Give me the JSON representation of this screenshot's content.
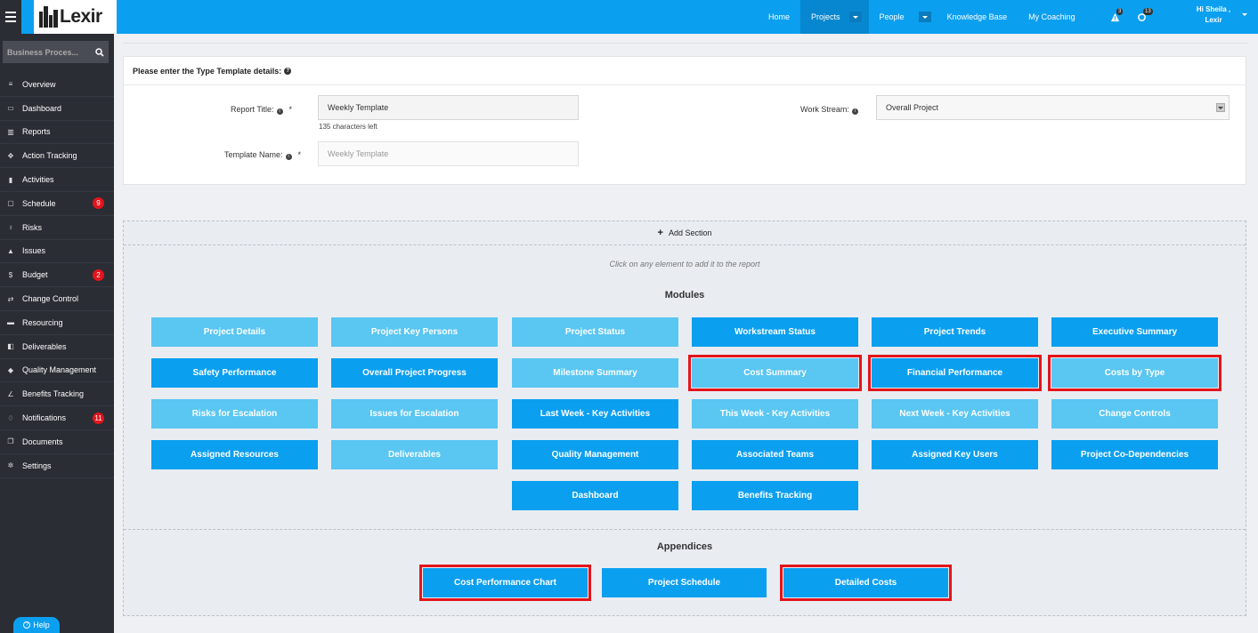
{
  "header": {
    "logo_text": "Lexir",
    "nav": [
      {
        "label": "Home"
      },
      {
        "label": "Projects"
      },
      {
        "label": "People"
      },
      {
        "label": "Knowledge Base"
      },
      {
        "label": "My Coaching"
      }
    ],
    "alerts_count": "3",
    "messages_count": "13",
    "greeting_line1": "Hi Sheila ,",
    "greeting_line2": "Lexir"
  },
  "sidebar": {
    "search_placeholder": "Business Proces...",
    "items": [
      {
        "label": "Overview",
        "icon": "list-icon"
      },
      {
        "label": "Dashboard",
        "icon": "dashboard-icon"
      },
      {
        "label": "Reports",
        "icon": "bar-chart-icon"
      },
      {
        "label": "Action Tracking",
        "icon": "crosshair-icon"
      },
      {
        "label": "Activities",
        "icon": "bookmark-icon"
      },
      {
        "label": "Schedule",
        "icon": "calendar-icon",
        "badge": "9"
      },
      {
        "label": "Risks",
        "icon": "lightbulb-icon"
      },
      {
        "label": "Issues",
        "icon": "warning-icon"
      },
      {
        "label": "Budget",
        "icon": "dollar-icon",
        "badge": "2"
      },
      {
        "label": "Change Control",
        "icon": "exchange-icon"
      },
      {
        "label": "Resourcing",
        "icon": "truck-icon"
      },
      {
        "label": "Deliverables",
        "icon": "box-icon"
      },
      {
        "label": "Quality Management",
        "icon": "tag-icon"
      },
      {
        "label": "Benefits Tracking",
        "icon": "line-chart-icon"
      },
      {
        "label": "Notifications",
        "icon": "bell-icon",
        "badge": "11"
      },
      {
        "label": "Documents",
        "icon": "documents-icon"
      },
      {
        "label": "Settings",
        "icon": "cogs-icon"
      }
    ],
    "help_label": "Help"
  },
  "form": {
    "heading": "Please enter the Type Template details:",
    "report_title_label": "Report Title:",
    "report_title_value": "Weekly Template",
    "report_title_hint": "135 characters left",
    "template_name_label": "Template Name:",
    "template_name_placeholder": "Weekly Template",
    "work_stream_label": "Work Stream:",
    "work_stream_value": "Overall Project",
    "required_mark": "*"
  },
  "builder": {
    "add_section_label": "Add Section",
    "click_hint": "Click on any element to add it to the report",
    "modules_title": "Modules",
    "appendices_title": "Appendices",
    "modules": [
      {
        "label": "Project Details",
        "style": "light"
      },
      {
        "label": "Project Key Persons",
        "style": "light"
      },
      {
        "label": "Project Status",
        "style": "light"
      },
      {
        "label": "Workstream Status",
        "style": "dark"
      },
      {
        "label": "Project Trends",
        "style": "dark"
      },
      {
        "label": "Executive Summary",
        "style": "dark"
      },
      {
        "label": "Safety Performance",
        "style": "dark"
      },
      {
        "label": "Overall Project Progress",
        "style": "dark"
      },
      {
        "label": "Milestone Summary",
        "style": "light"
      },
      {
        "label": "Cost Summary",
        "style": "light",
        "highlighted": true
      },
      {
        "label": "Financial Performance",
        "style": "dark",
        "highlighted": true
      },
      {
        "label": "Costs by Type",
        "style": "light",
        "highlighted": true
      },
      {
        "label": "Risks for Escalation",
        "style": "light"
      },
      {
        "label": "Issues for Escalation",
        "style": "light"
      },
      {
        "label": "Last Week - Key Activities",
        "style": "dark"
      },
      {
        "label": "This Week - Key Activities",
        "style": "light"
      },
      {
        "label": "Next Week - Key Activities",
        "style": "light"
      },
      {
        "label": "Change Controls",
        "style": "light"
      },
      {
        "label": "Assigned Resources",
        "style": "dark"
      },
      {
        "label": "Deliverables",
        "style": "light"
      },
      {
        "label": "Quality Management",
        "style": "dark"
      },
      {
        "label": "Associated Teams",
        "style": "dark"
      },
      {
        "label": "Assigned Key Users",
        "style": "dark"
      },
      {
        "label": "Project Co-Dependencies",
        "style": "dark"
      },
      {
        "label": "Dashboard",
        "style": "dark"
      },
      {
        "label": "Benefits Tracking",
        "style": "dark"
      }
    ],
    "appendices": [
      {
        "label": "Cost Performance Chart",
        "style": "dark",
        "highlighted": true
      },
      {
        "label": "Project Schedule",
        "style": "dark"
      },
      {
        "label": "Detailed Costs",
        "style": "dark",
        "highlighted": true
      }
    ]
  },
  "colors": {
    "brand_blue": "#0b9ff0",
    "light_blue": "#5ac6f2",
    "sidebar_bg": "#2b2d35",
    "highlight_red": "#e3141b"
  }
}
